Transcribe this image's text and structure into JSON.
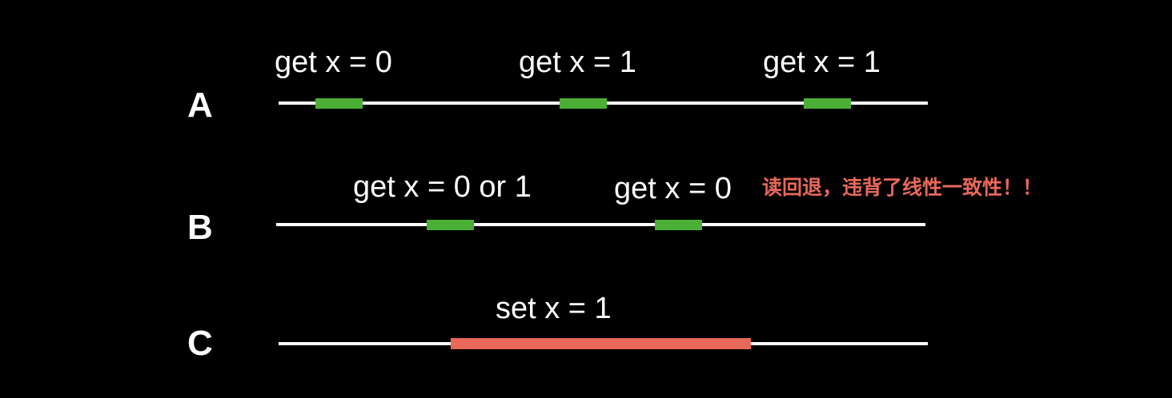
{
  "colors": {
    "background": "#000000",
    "timeline": "#ffffff",
    "read_op": "#4caf35",
    "write_op": "#e8685a",
    "note_text": "#e8685a"
  },
  "rows": [
    {
      "id": "A",
      "label": "A",
      "ops": [
        {
          "label": "get x = 0",
          "kind": "read"
        },
        {
          "label": "get x = 1",
          "kind": "read"
        },
        {
          "label": "get x = 1",
          "kind": "read"
        }
      ]
    },
    {
      "id": "B",
      "label": "B",
      "ops": [
        {
          "label": "get x = 0 or 1",
          "kind": "read"
        },
        {
          "label": "get x = 0",
          "kind": "read"
        }
      ],
      "note": "读回退，违背了线性一致性！！"
    },
    {
      "id": "C",
      "label": "C",
      "ops": [
        {
          "label": "set x = 1",
          "kind": "write"
        }
      ]
    }
  ]
}
